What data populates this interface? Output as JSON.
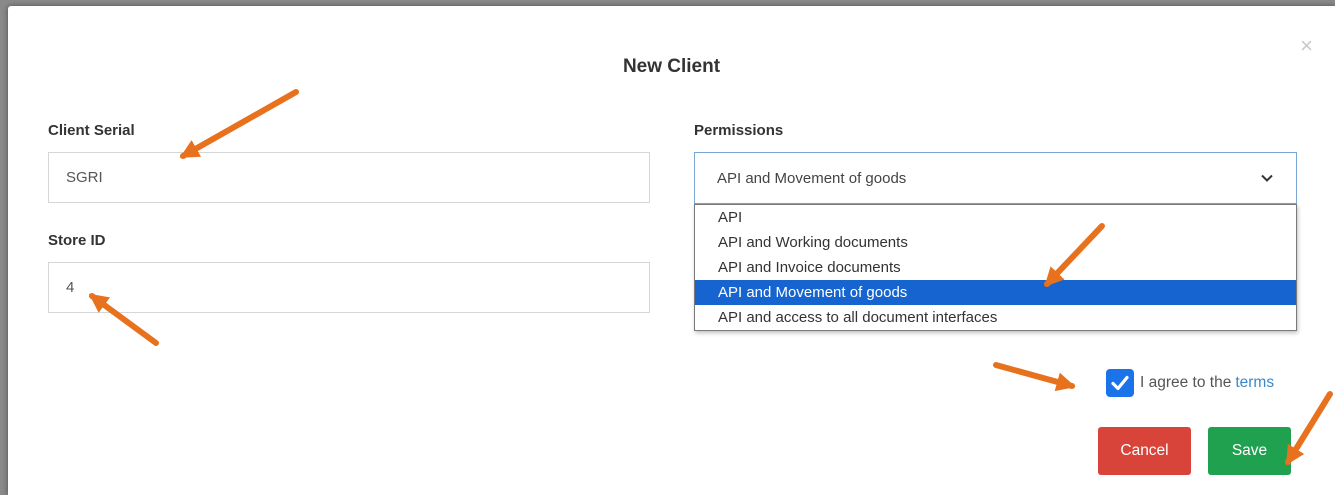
{
  "modal": {
    "title": "New Client",
    "close_symbol": "×"
  },
  "form": {
    "client_serial_label": "Client Serial",
    "client_serial_value": "SGRI",
    "store_id_label": "Store ID",
    "store_id_value": "4",
    "permissions_label": "Permissions",
    "permissions_selected": "API and Movement of goods",
    "permissions_options": [
      "API",
      "API and Working documents",
      "API and Invoice documents",
      "API and Movement of goods",
      "API and access to all document interfaces"
    ],
    "agree_text": "I agree to the",
    "terms_link": "terms"
  },
  "buttons": {
    "cancel": "Cancel",
    "save": "Save"
  },
  "colors": {
    "cancel": "#d9443a",
    "save": "#20a150",
    "selected_option": "#1664d0",
    "checkbox": "#1a73e8",
    "annotation_arrow": "#e8711e"
  },
  "icons": {
    "close": "close-icon",
    "select": "chevron-down-icon",
    "checkbox": "checkmark-icon",
    "annotations": "arrow-icon"
  }
}
